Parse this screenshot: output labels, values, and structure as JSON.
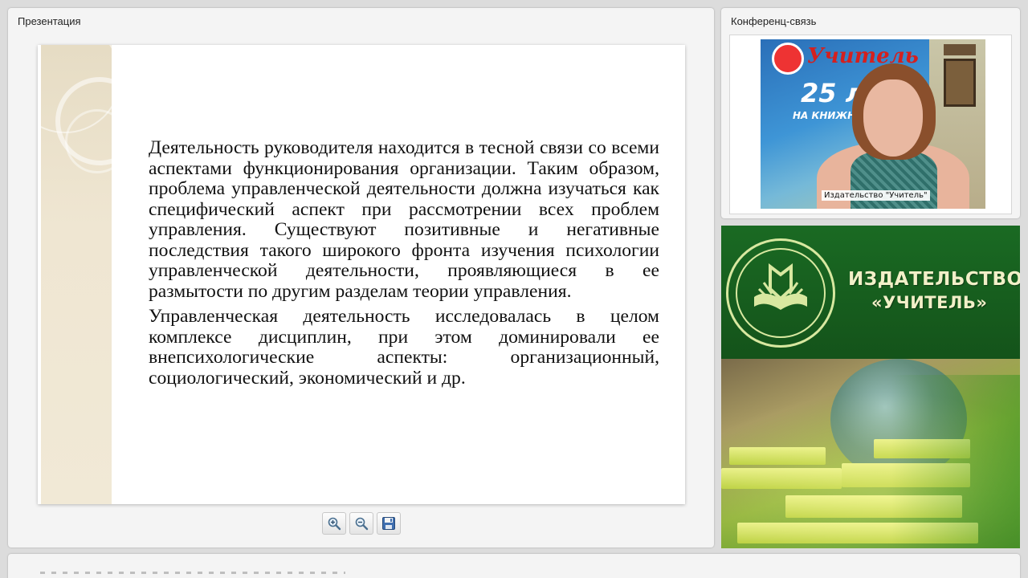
{
  "presentation": {
    "title": "Презентация",
    "slide": {
      "paragraphs": [
        "Деятельность руководителя находится в тесной связи со всеми аспектами функционирования организации. Таким образом, проблема управленческой деятельности должна изучаться как специфический аспект при рассмотрении всех проблем управления. Существуют позитивные и негативные последствия такого широкого фронта изучения психологии управленческой деятельности, проявляющиеся в ее размытости по другим разделам теории управления.",
        "Управленческая деятельность исследовалась в целом комплексе дисциплин, при этом доминировали ее внепсихологические аспекты: организационный, социологический, экономический и др."
      ]
    },
    "toolbar": {
      "zoom_in_icon": "zoom-in-icon",
      "zoom_out_icon": "zoom-out-icon",
      "save_icon": "floppy-disk-icon"
    }
  },
  "conference": {
    "title": "Конференц-связь",
    "video_caption": "Издательство \"Учитель\"",
    "banner_word": "Учитель",
    "banner_number": "25 л",
    "banner_sub": "НА КНИЖНО"
  },
  "publisher": {
    "name_line1": "ИЗДАТЕЛЬСТВО",
    "name_line2": "«УЧИТЕЛЬ»",
    "brand_color": "#1a6a23",
    "text_color": "#f2f0c8"
  }
}
